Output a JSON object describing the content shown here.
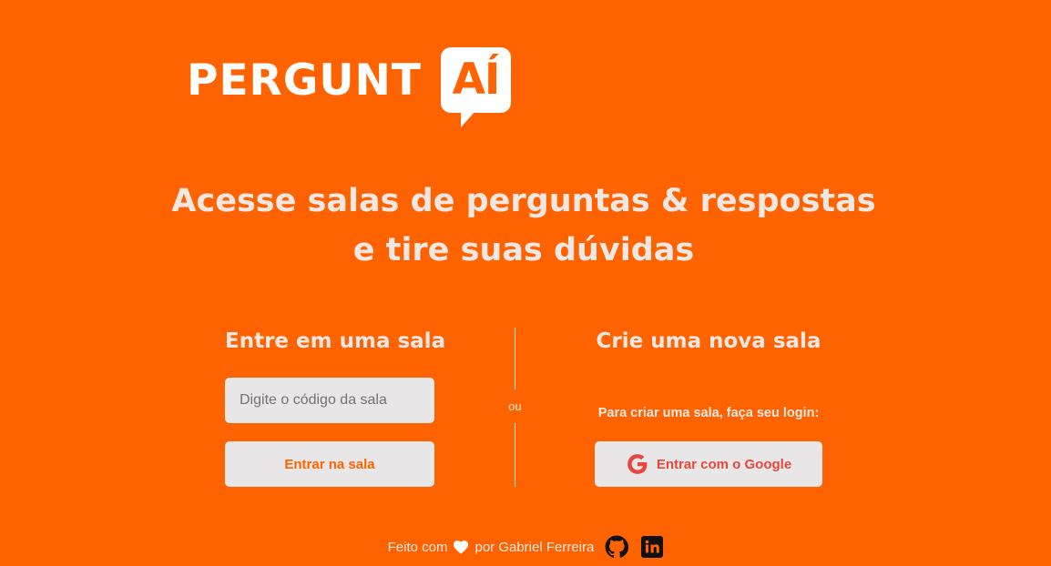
{
  "logo": {
    "word": "PERGUNT",
    "bubble": "AÍ"
  },
  "headline": {
    "line1": "Acesse salas de perguntas & respostas",
    "line2": "e tire suas dúvidas"
  },
  "join": {
    "title": "Entre em uma sala",
    "input_placeholder": "Digite o código da sala",
    "button_label": "Entrar na sala"
  },
  "divider": {
    "label": "ou"
  },
  "create": {
    "title": "Crie uma nova sala",
    "hint": "Para criar uma sala, faça seu login:",
    "google_button_label": "Entrar com o Google"
  },
  "footer": {
    "made_with": "Feito com",
    "by_author": "por Gabriel Ferreira",
    "icons": [
      "heart-icon",
      "github-icon",
      "linkedin-icon"
    ]
  },
  "colors": {
    "background": "#ff6300",
    "text": "#f2e7e2",
    "button_bg": "#e8e6e6",
    "google_red": "#e8473e"
  }
}
